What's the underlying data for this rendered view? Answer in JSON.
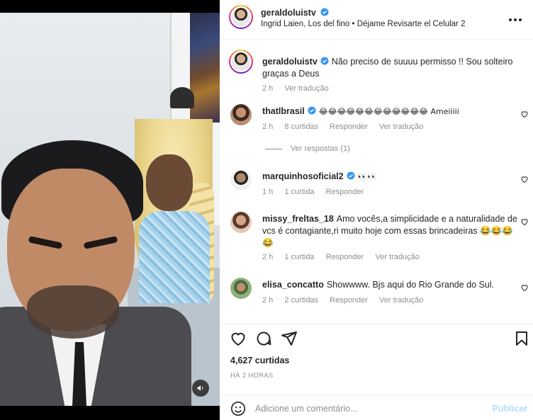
{
  "post": {
    "username": "geraldoluistv",
    "audio": "Ingrid Laien, Los del fino • Déjame Revisarte el Celular 2"
  },
  "caption": {
    "username": "geraldoluistv",
    "text": "Não preciso de suuuu permisso !! Sou solteiro graças a Deus",
    "time": "2 h",
    "translate": "Ver tradução"
  },
  "comments": [
    {
      "username": "thatlbrasil",
      "text": "😂😂😂😂😂😂😂😂😂😂😂😂 Ameiiiii",
      "time": "2 h",
      "likes": "8 curtidas",
      "reply": "Responder",
      "translate": "Ver tradução"
    },
    {
      "username": "marquinhosoficial2",
      "text": "👀👀",
      "time": "1 h",
      "likes": "1 curtida",
      "reply": "Responder"
    },
    {
      "username": "missy_freltas_18",
      "text": "Amo vocês,a simplicidade e a naturalidade de vcs é contagiante,ri muito hoje com essas brincadeiras 😂😂😂😂",
      "time": "2 h",
      "likes": "1 curtida",
      "reply": "Responder",
      "translate": "Ver tradução"
    },
    {
      "username": "elisa_concatto",
      "text": "Showwww. Bjs aqui do Rio Grande do Sul.",
      "time": "2 h",
      "likes": "2 curtidas",
      "reply": "Responder",
      "translate": "Ver tradução"
    }
  ],
  "view_replies": "Ver respostas (1)",
  "stats": {
    "likes": "4,627 curtidas",
    "time": "HÁ 2 HORAS"
  },
  "composer": {
    "placeholder": "Adicione um comentário...",
    "post_label": "Publicar"
  },
  "colors": {
    "verified": "#3897f0",
    "muted_text": "#8e8e8e",
    "publish_disabled": "#b3dbff"
  },
  "icons": [
    "volume-icon",
    "more-icon",
    "heart-icon",
    "comment-icon",
    "share-icon",
    "bookmark-icon",
    "emoji-icon",
    "verified-icon"
  ]
}
